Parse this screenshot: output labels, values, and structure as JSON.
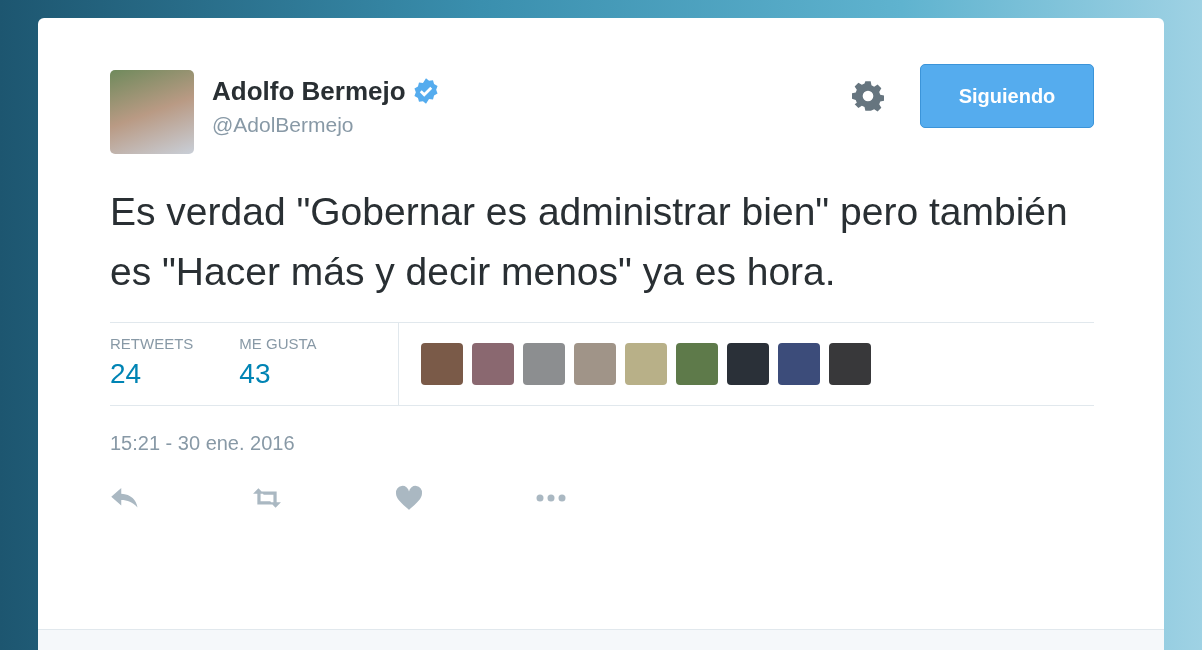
{
  "author": {
    "name": "Adolfo Bermejo",
    "handle": "@AdolBermejo",
    "verified": true
  },
  "follow_button": {
    "label": "Siguiendo"
  },
  "tweet": {
    "text": "Es verdad \"Gobernar es administrar bien\" pero también es \"Hacer más y decir menos\" ya es hora."
  },
  "stats": [
    {
      "label": "RETWEETS",
      "value": "24"
    },
    {
      "label": "ME GUSTA",
      "value": "43"
    }
  ],
  "timestamp": "15:21 - 30 ene. 2016"
}
